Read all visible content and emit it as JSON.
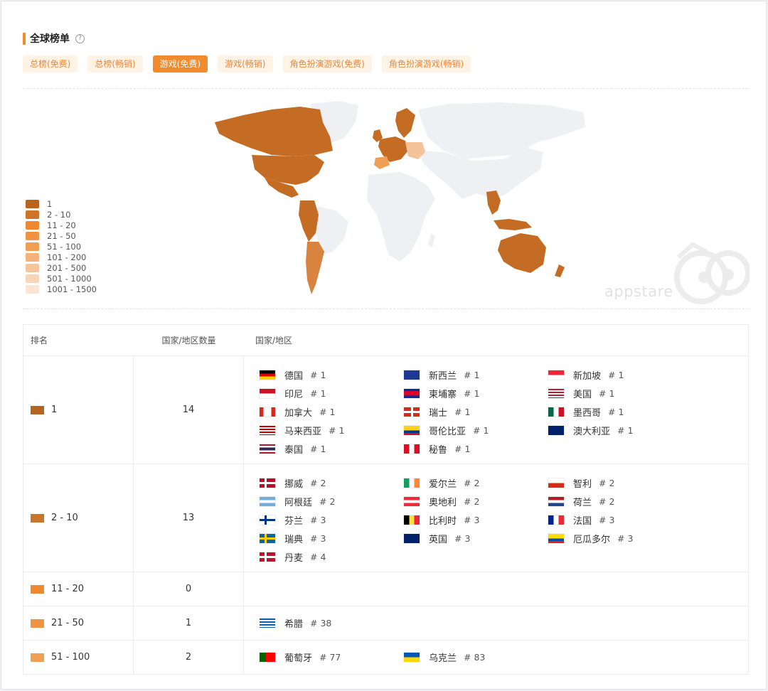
{
  "header": {
    "title": "全球榜单",
    "help_icon": "?"
  },
  "tabs": [
    {
      "label": "总榜(免费)",
      "active": false
    },
    {
      "label": "总榜(畅销)",
      "active": false
    },
    {
      "label": "游戏(免费)",
      "active": true
    },
    {
      "label": "游戏(畅销)",
      "active": false
    },
    {
      "label": "角色扮演游戏(免费)",
      "active": false
    },
    {
      "label": "角色扮演游戏(畅销)",
      "active": false
    }
  ],
  "legend": [
    {
      "label": "1",
      "color": "#b86420"
    },
    {
      "label": "2 - 10",
      "color": "#cc7428"
    },
    {
      "label": "11 - 20",
      "color": "#ee8932"
    },
    {
      "label": "21 - 50",
      "color": "#ef9445"
    },
    {
      "label": "51 - 100",
      "color": "#f0a055"
    },
    {
      "label": "101 - 200",
      "color": "#f4b37a"
    },
    {
      "label": "201 - 500",
      "color": "#f6c59b"
    },
    {
      "label": "501 - 1000",
      "color": "#f8d6b9"
    },
    {
      "label": "1001 - 1500",
      "color": "#fae4d3"
    }
  ],
  "watermark": {
    "text": "appstare"
  },
  "table": {
    "headers": {
      "rank": "排名",
      "count": "国家/地区数量",
      "countries": "国家/地区"
    },
    "rows": [
      {
        "rank": "1",
        "color": "#b86420",
        "count": "14",
        "countries": [
          {
            "name": "德国",
            "rank": "# 1",
            "flag": "de"
          },
          {
            "name": "新西兰",
            "rank": "# 1",
            "flag": "nz"
          },
          {
            "name": "新加坡",
            "rank": "# 1",
            "flag": "sg"
          },
          {
            "name": "印尼",
            "rank": "# 1",
            "flag": "id"
          },
          {
            "name": "柬埔寨",
            "rank": "# 1",
            "flag": "kh"
          },
          {
            "name": "美国",
            "rank": "# 1",
            "flag": "us"
          },
          {
            "name": "加拿大",
            "rank": "# 1",
            "flag": "ca"
          },
          {
            "name": "瑞士",
            "rank": "# 1",
            "flag": "ch"
          },
          {
            "name": "墨西哥",
            "rank": "# 1",
            "flag": "mx"
          },
          {
            "name": "马来西亚",
            "rank": "# 1",
            "flag": "my"
          },
          {
            "name": "哥伦比亚",
            "rank": "# 1",
            "flag": "co"
          },
          {
            "name": "澳大利亚",
            "rank": "# 1",
            "flag": "au"
          },
          {
            "name": "泰国",
            "rank": "# 1",
            "flag": "th"
          },
          {
            "name": "秘鲁",
            "rank": "# 1",
            "flag": "pe"
          }
        ]
      },
      {
        "rank": "2 - 10",
        "color": "#cc7428",
        "count": "13",
        "countries": [
          {
            "name": "挪威",
            "rank": "# 2",
            "flag": "no"
          },
          {
            "name": "爱尔兰",
            "rank": "# 2",
            "flag": "ie"
          },
          {
            "name": "智利",
            "rank": "# 2",
            "flag": "cl"
          },
          {
            "name": "阿根廷",
            "rank": "# 2",
            "flag": "ar"
          },
          {
            "name": "奥地利",
            "rank": "# 2",
            "flag": "at"
          },
          {
            "name": "荷兰",
            "rank": "# 2",
            "flag": "nl"
          },
          {
            "name": "芬兰",
            "rank": "# 3",
            "flag": "fi"
          },
          {
            "name": "比利时",
            "rank": "# 3",
            "flag": "be"
          },
          {
            "name": "法国",
            "rank": "# 3",
            "flag": "fr"
          },
          {
            "name": "瑞典",
            "rank": "# 3",
            "flag": "se"
          },
          {
            "name": "英国",
            "rank": "# 3",
            "flag": "gb"
          },
          {
            "name": "厄瓜多尔",
            "rank": "# 3",
            "flag": "ec"
          },
          {
            "name": "丹麦",
            "rank": "# 4",
            "flag": "dk"
          }
        ]
      },
      {
        "rank": "11 - 20",
        "color": "#ee8932",
        "count": "0",
        "countries": []
      },
      {
        "rank": "21 - 50",
        "color": "#ef9445",
        "count": "1",
        "countries": [
          {
            "name": "希腊",
            "rank": "# 38",
            "flag": "gr"
          }
        ]
      },
      {
        "rank": "51 - 100",
        "color": "#f0a055",
        "count": "2",
        "countries": [
          {
            "name": "葡萄牙",
            "rank": "# 77",
            "flag": "pt"
          },
          {
            "name": "乌克兰",
            "rank": "# 83",
            "flag": "ua"
          }
        ]
      }
    ]
  }
}
